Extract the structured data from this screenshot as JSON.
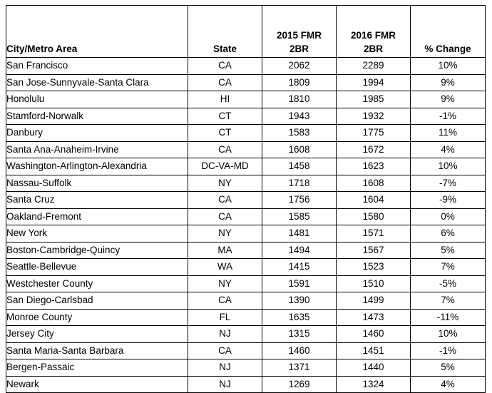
{
  "table": {
    "columns": [
      {
        "key": "city",
        "label": "City/Metro Area",
        "align": "left"
      },
      {
        "key": "state",
        "label": "State",
        "align": "center"
      },
      {
        "key": "fmr2015",
        "label_line1": "2015 FMR",
        "label_line2": "2BR",
        "align": "center"
      },
      {
        "key": "fmr2016",
        "label_line1": "2016 FMR",
        "label_line2": "2BR",
        "align": "center"
      },
      {
        "key": "change",
        "label": "% Change",
        "align": "center"
      }
    ],
    "rows": [
      {
        "city": "San Francisco",
        "state": "CA",
        "fmr2015": "2062",
        "fmr2016": "2289",
        "change": "10%"
      },
      {
        "city": "San Jose-Sunnyvale-Santa Clara",
        "state": "CA",
        "fmr2015": "1809",
        "fmr2016": "1994",
        "change": "9%"
      },
      {
        "city": "Honolulu",
        "state": "HI",
        "fmr2015": "1810",
        "fmr2016": "1985",
        "change": "9%"
      },
      {
        "city": "Stamford-Norwalk",
        "state": "CT",
        "fmr2015": "1943",
        "fmr2016": "1932",
        "change": "-1%"
      },
      {
        "city": "Danbury",
        "state": "CT",
        "fmr2015": "1583",
        "fmr2016": "1775",
        "change": "11%"
      },
      {
        "city": "Santa Ana-Anaheim-Irvine",
        "state": "CA",
        "fmr2015": "1608",
        "fmr2016": "1672",
        "change": "4%"
      },
      {
        "city": "Washington-Arlington-Alexandria",
        "state": "DC-VA-MD",
        "fmr2015": "1458",
        "fmr2016": "1623",
        "change": "10%"
      },
      {
        "city": "Nassau-Suffolk",
        "state": "NY",
        "fmr2015": "1718",
        "fmr2016": "1608",
        "change": "-7%"
      },
      {
        "city": "Santa Cruz",
        "state": "CA",
        "fmr2015": "1756",
        "fmr2016": "1604",
        "change": "-9%"
      },
      {
        "city": "Oakland-Fremont",
        "state": "CA",
        "fmr2015": "1585",
        "fmr2016": "1580",
        "change": "0%"
      },
      {
        "city": "New York",
        "state": "NY",
        "fmr2015": "1481",
        "fmr2016": "1571",
        "change": "6%"
      },
      {
        "city": "Boston-Cambridge-Quincy",
        "state": "MA",
        "fmr2015": "1494",
        "fmr2016": "1567",
        "change": "5%"
      },
      {
        "city": "Seattle-Bellevue",
        "state": "WA",
        "fmr2015": "1415",
        "fmr2016": "1523",
        "change": "7%"
      },
      {
        "city": "Westchester County",
        "state": "NY",
        "fmr2015": "1591",
        "fmr2016": "1510",
        "change": "-5%"
      },
      {
        "city": "San Diego-Carlsbad",
        "state": "CA",
        "fmr2015": "1390",
        "fmr2016": "1499",
        "change": "7%"
      },
      {
        "city": "Monroe County",
        "state": "FL",
        "fmr2015": "1635",
        "fmr2016": "1473",
        "change": "-11%"
      },
      {
        "city": "Jersey City",
        "state": "NJ",
        "fmr2015": "1315",
        "fmr2016": "1460",
        "change": "10%"
      },
      {
        "city": "Santa Maria-Santa Barbara",
        "state": "CA",
        "fmr2015": "1460",
        "fmr2016": "1451",
        "change": "-1%"
      },
      {
        "city": "Bergen-Passaic",
        "state": "NJ",
        "fmr2015": "1371",
        "fmr2016": "1440",
        "change": "5%"
      },
      {
        "city": "Newark",
        "state": "NJ",
        "fmr2015": "1269",
        "fmr2016": "1324",
        "change": "4%"
      }
    ]
  },
  "chart_data": {
    "type": "table",
    "title": "",
    "columns": [
      "City/Metro Area",
      "State",
      "2015 FMR 2BR",
      "2016 FMR 2BR",
      "% Change"
    ],
    "rows": [
      [
        "San Francisco",
        "CA",
        2062,
        2289,
        "10%"
      ],
      [
        "San Jose-Sunnyvale-Santa Clara",
        "CA",
        1809,
        1994,
        "9%"
      ],
      [
        "Honolulu",
        "HI",
        1810,
        1985,
        "9%"
      ],
      [
        "Stamford-Norwalk",
        "CT",
        1943,
        1932,
        "-1%"
      ],
      [
        "Danbury",
        "CT",
        1583,
        1775,
        "11%"
      ],
      [
        "Santa Ana-Anaheim-Irvine",
        "CA",
        1608,
        1672,
        "4%"
      ],
      [
        "Washington-Arlington-Alexandria",
        "DC-VA-MD",
        1458,
        1623,
        "10%"
      ],
      [
        "Nassau-Suffolk",
        "NY",
        1718,
        1608,
        "-7%"
      ],
      [
        "Santa Cruz",
        "CA",
        1756,
        1604,
        "-9%"
      ],
      [
        "Oakland-Fremont",
        "CA",
        1585,
        1580,
        "0%"
      ],
      [
        "New York",
        "NY",
        1481,
        1571,
        "6%"
      ],
      [
        "Boston-Cambridge-Quincy",
        "MA",
        1494,
        1567,
        "5%"
      ],
      [
        "Seattle-Bellevue",
        "WA",
        1415,
        1523,
        "7%"
      ],
      [
        "Westchester County",
        "NY",
        1591,
        1510,
        "-5%"
      ],
      [
        "San Diego-Carlsbad",
        "CA",
        1390,
        1499,
        "7%"
      ],
      [
        "Monroe County",
        "FL",
        1635,
        1473,
        "-11%"
      ],
      [
        "Jersey City",
        "NJ",
        1315,
        1460,
        "10%"
      ],
      [
        "Santa Maria-Santa Barbara",
        "CA",
        1460,
        1451,
        "-1%"
      ],
      [
        "Bergen-Passaic",
        "NJ",
        1371,
        1440,
        "5%"
      ],
      [
        "Newark",
        "NJ",
        1269,
        1324,
        "4%"
      ]
    ]
  }
}
